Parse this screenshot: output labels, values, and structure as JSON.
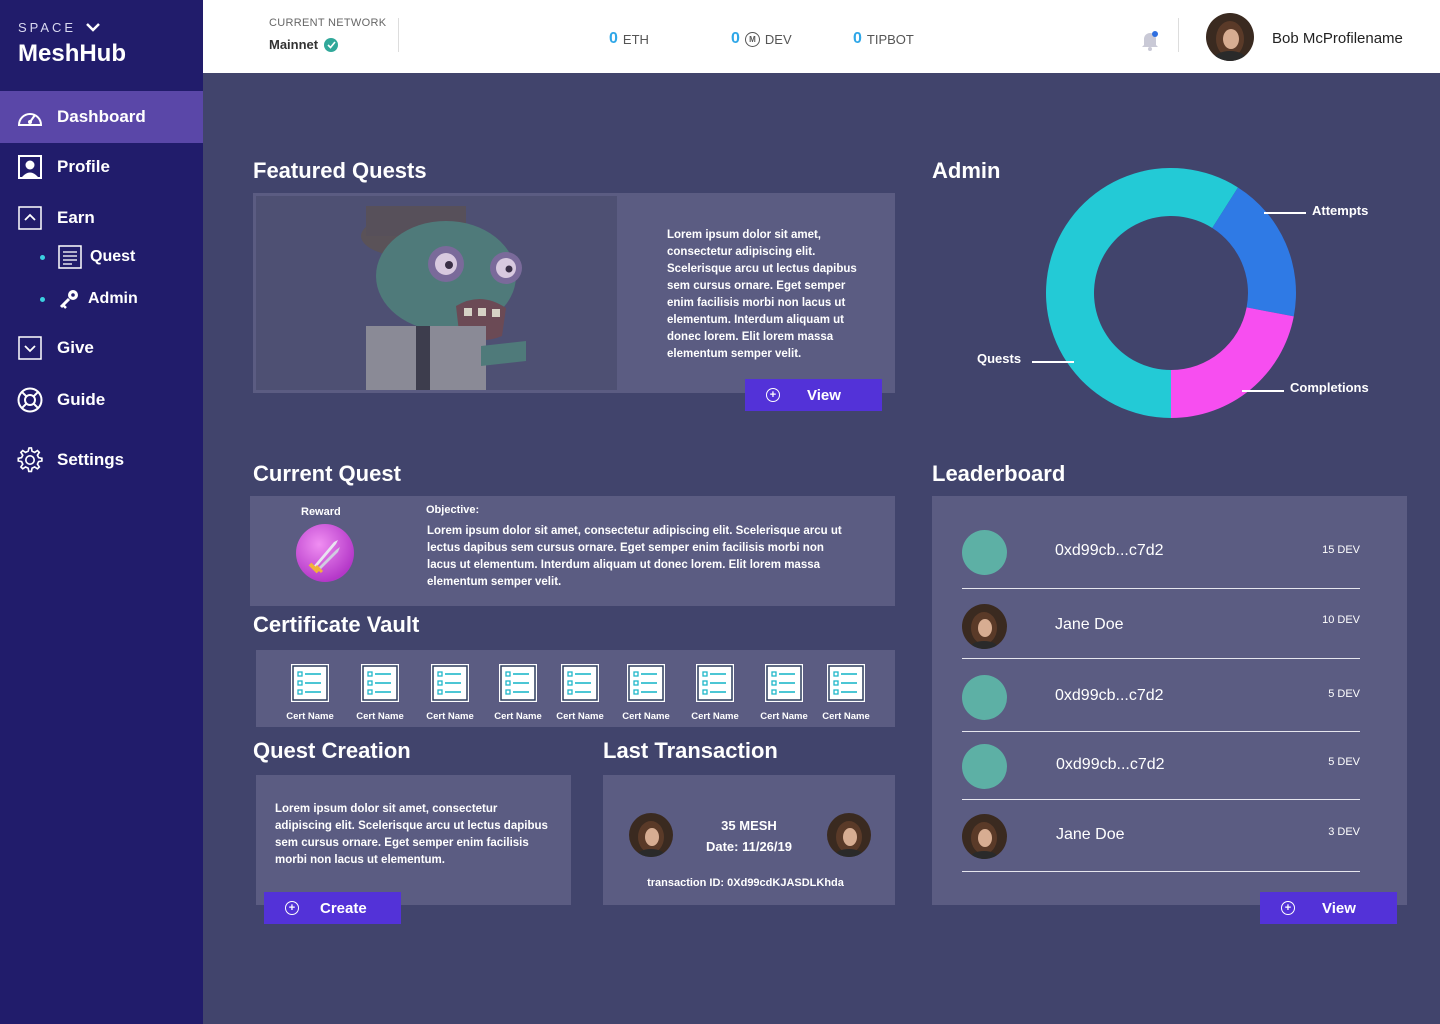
{
  "sidebar": {
    "space_label": "SPACE",
    "brand": "MeshHub",
    "items": [
      {
        "label": "Dashboard",
        "icon": "dashboard-icon"
      },
      {
        "label": "Profile",
        "icon": "profile-icon"
      },
      {
        "label": "Earn",
        "icon": "chevron-up-icon"
      },
      {
        "label": "Give",
        "icon": "chevron-down-icon"
      },
      {
        "label": "Guide",
        "icon": "guide-icon"
      },
      {
        "label": "Settings",
        "icon": "gear-icon"
      }
    ],
    "sub_items": [
      {
        "label": "Quest",
        "icon": "document-icon"
      },
      {
        "label": "Admin",
        "icon": "key-icon"
      }
    ]
  },
  "header": {
    "network_label": "CURRENT NETWORK",
    "network_value": "Mainnet",
    "balances": [
      {
        "amount": "0",
        "unit": "ETH"
      },
      {
        "amount": "0",
        "unit": "DEV"
      },
      {
        "amount": "0",
        "unit": "TIPBOT"
      }
    ],
    "user_name": "Bob McProfilename"
  },
  "featured": {
    "title": "Featured Quests",
    "text": "Lorem ipsum dolor sit amet, consectetur adipiscing elit. Scelerisque arcu ut lectus dapibus sem cursus ornare. Eget semper enim facilisis morbi non lacus ut elementum. Interdum aliquam ut donec lorem. Elit lorem massa elementum semper velit.",
    "button": "View"
  },
  "admin": {
    "title": "Admin",
    "labels": {
      "attempts": "Attempts",
      "quests": "Quests",
      "completions": "Completions"
    }
  },
  "chart_data": {
    "type": "pie",
    "categories": [
      "Quests",
      "Attempts",
      "Completions"
    ],
    "values": [
      59,
      19,
      22
    ],
    "colors": [
      "#23cad6",
      "#2f7ae5",
      "#f74ef0"
    ]
  },
  "current_quest": {
    "title": "Current Quest",
    "reward_label": "Reward",
    "objective_label": "Objective:",
    "objective_text": "Lorem ipsum dolor sit amet, consectetur adipiscing elit. Scelerisque arcu ut lectus dapibus sem cursus ornare. Eget semper enim facilisis morbi non lacus ut elementum. Interdum aliquam ut donec lorem. Elit lorem massa elementum semper velit."
  },
  "vault": {
    "title": "Certificate Vault",
    "certs": [
      "Cert Name",
      "Cert Name",
      "Cert Name",
      "Cert Name",
      "Cert Name",
      "Cert Name",
      "Cert Name",
      "Cert Name",
      "Cert Name"
    ]
  },
  "creation": {
    "title": "Quest Creation",
    "text": "Lorem ipsum dolor sit amet, consectetur adipiscing elit. Scelerisque arcu ut lectus dapibus sem cursus ornare. Eget semper enim facilisis morbi non lacus ut elementum.",
    "button": "Create"
  },
  "transaction": {
    "title": "Last Transaction",
    "amount": "35 MESH",
    "date": "Date: 11/26/19",
    "tx_id": "transaction ID: 0Xd99cdKJASDLKhda"
  },
  "leaderboard": {
    "title": "Leaderboard",
    "rows": [
      {
        "name": "0xd99cb...c7d2",
        "score": "15 DEV",
        "avatar": "teal"
      },
      {
        "name": "Jane Doe",
        "score": "10 DEV",
        "avatar": "photo"
      },
      {
        "name": "0xd99cb...c7d2",
        "score": "5 DEV",
        "avatar": "teal"
      },
      {
        "name": "0xd99cb...c7d2",
        "score": "5 DEV",
        "avatar": "teal"
      },
      {
        "name": "Jane Doe",
        "score": "3 DEV",
        "avatar": "photo"
      }
    ],
    "button": "View"
  }
}
